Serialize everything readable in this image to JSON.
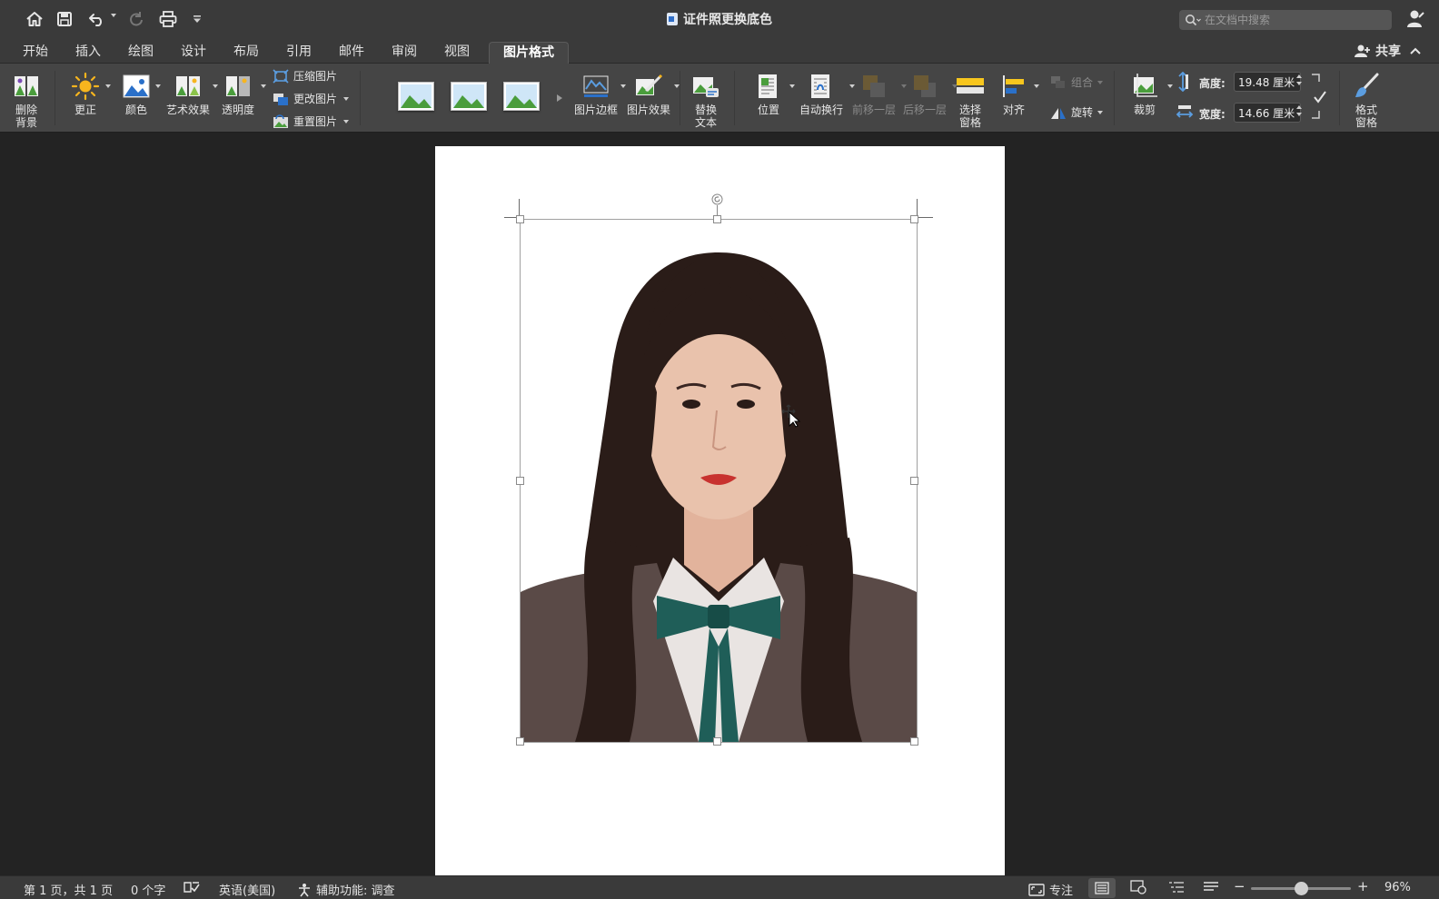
{
  "window": {
    "title": "证件照更换底色"
  },
  "search": {
    "placeholder": "在文档中搜索"
  },
  "tabs": [
    {
      "label": "开始"
    },
    {
      "label": "插入"
    },
    {
      "label": "绘图"
    },
    {
      "label": "设计"
    },
    {
      "label": "布局"
    },
    {
      "label": "引用"
    },
    {
      "label": "邮件"
    },
    {
      "label": "审阅"
    },
    {
      "label": "视图"
    },
    {
      "label": "图片格式",
      "active": true
    }
  ],
  "share": {
    "label": "共享"
  },
  "ribbon": {
    "remove_bg": "删除\n背景",
    "corrections": "更正",
    "color": "颜色",
    "artistic": "艺术效果",
    "transparency": "透明度",
    "compress": "压缩图片",
    "change_picture": "更改图片",
    "reset_picture": "重置图片",
    "picture_border": "图片边框",
    "picture_effects": "图片效果",
    "alt_text": "替换\n文本",
    "position": "位置",
    "wrap_text": "自动换行",
    "bring_forward": "前移一层",
    "send_backward": "后移一层",
    "selection_pane": "选择\n窗格",
    "align": "对齐",
    "group": "组合",
    "rotate": "旋转",
    "crop": "裁剪",
    "height_label": "高度:",
    "height_value": "19.48 厘米",
    "width_label": "宽度:",
    "width_value": "14.66 厘米",
    "format_pane": "格式\n窗格"
  },
  "status": {
    "page": "第 1 页，共 1 页",
    "words": "0 个字",
    "language": "英语(美国)",
    "accessibility": "辅助功能: 调查",
    "focus": "专注",
    "zoom": "96%",
    "zoom_fraction": 0.5
  },
  "colors": {
    "titlebar": "#3a3a3a",
    "ribbon": "#454545",
    "workspace": "#232323",
    "page": "#ffffff",
    "bow": "#1f5e58",
    "jacket": "#5a4a47",
    "hair": "#2a1c18",
    "skin": "#e9c2ac"
  }
}
